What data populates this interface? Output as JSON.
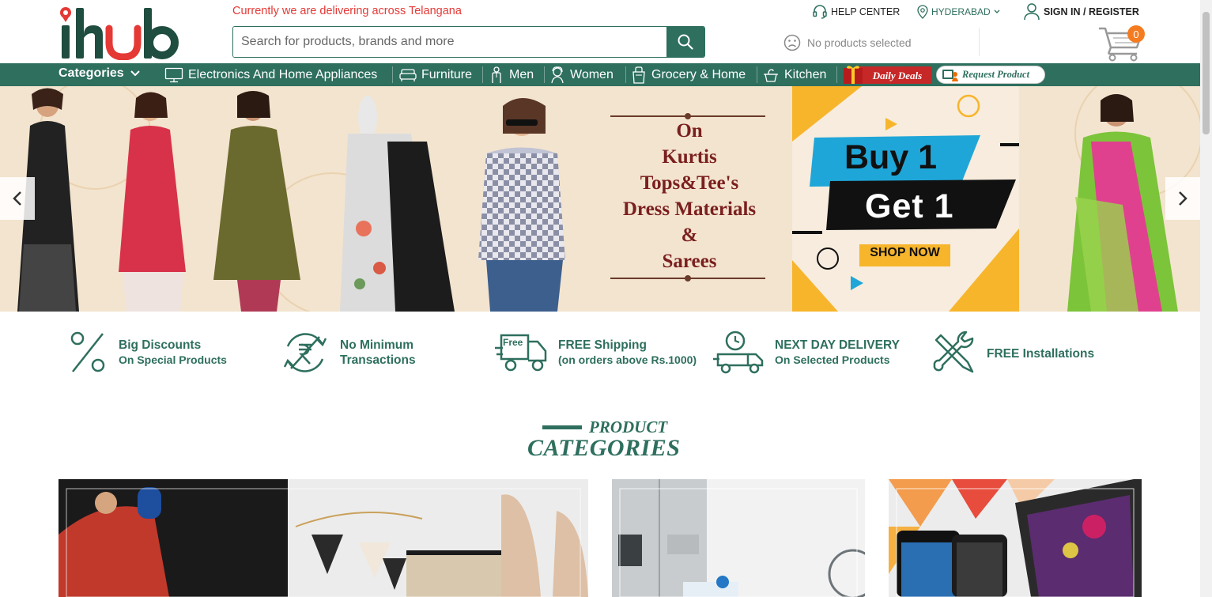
{
  "header": {
    "delivery_note": "Currently we are delivering across Telangana",
    "search_placeholder": "Search for products, brands and more",
    "help_center": "HELP CENTER",
    "city": "HYDERABAD",
    "sign_in": "SIGN IN / REGISTER",
    "no_products": "No products selected",
    "cart_count": "0"
  },
  "nav": {
    "categories": "Categories",
    "items": [
      "Electronics And Home Appliances",
      "Furniture",
      "Men",
      "Women",
      "Grocery & Home",
      "Kitchen"
    ],
    "daily_deals": "Daily Deals",
    "request_product": "Request Product"
  },
  "banner": {
    "lines": [
      "On",
      "Kurtis",
      "Tops&Tee's",
      "Dress Materials",
      "&",
      "Sarees"
    ],
    "buy": "Buy 1",
    "get": "Get 1",
    "shop_now": "SHOP NOW"
  },
  "features": [
    {
      "title": "Big Discounts",
      "sub": "On Special Products"
    },
    {
      "title": "No Minimum",
      "sub": "Transactions"
    },
    {
      "title": "FREE Shipping",
      "sub": "(on orders above Rs.1000)",
      "badge": "Free"
    },
    {
      "title": "NEXT DAY DELIVERY",
      "sub": "On Selected Products"
    },
    {
      "title": "FREE Installations",
      "sub": ""
    }
  ],
  "product_categories": {
    "small": "PRODUCT",
    "big": "CATEGORIES"
  },
  "colors": {
    "brand_green": "#2e6f5e",
    "accent_red": "#e53935",
    "cart_badge": "#f47b20",
    "banner_bg": "#f3e4cf",
    "banner_text": "#7a1f1f"
  },
  "icons": [
    "search-icon",
    "headset-icon",
    "location-pin-icon",
    "user-icon",
    "sad-face-icon",
    "cart-icon",
    "chevron-down-icon",
    "chevron-left-icon",
    "chevron-right-icon",
    "percent-icon",
    "rupee-icon",
    "truck-icon",
    "clock-truck-icon",
    "tools-icon"
  ]
}
